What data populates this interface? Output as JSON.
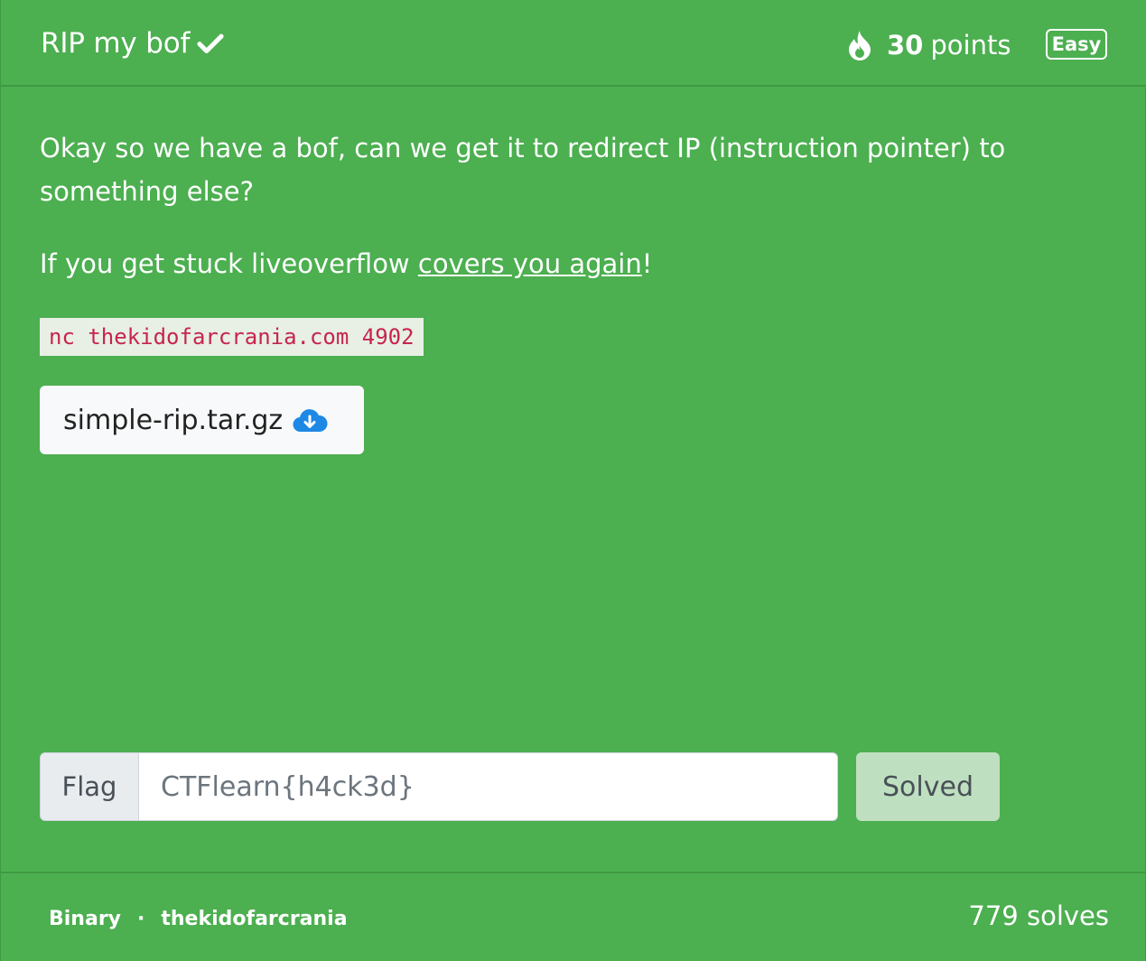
{
  "challenge": {
    "title": "RIP my bof",
    "points_value": "30",
    "points_label": "points",
    "difficulty": "Easy",
    "solved_icon": "check-icon",
    "points_icon": "fire-icon"
  },
  "description": {
    "paragraph_1": "Okay so we have a bof, can we get it to redirect IP (instruction pointer) to something else?",
    "paragraph_2_prefix": "If you get stuck liveoverflow ",
    "paragraph_2_link": "covers you again",
    "paragraph_2_suffix": "!",
    "connection": "nc thekidofarcrania.com 4902"
  },
  "attachment": {
    "filename": "simple-rip.tar.gz",
    "icon": "cloud-download-icon"
  },
  "flag_form": {
    "label": "Flag",
    "placeholder": "CTFlearn{h4ck3d}",
    "value": "",
    "submit_label": "Solved"
  },
  "footer": {
    "category": "Binary",
    "separator": "·",
    "author": "thekidofarcrania",
    "solves": "779 solves"
  },
  "colors": {
    "card_bg": "#4caf50",
    "code_text": "#c7254e",
    "cloud_icon": "#1e88e5",
    "solved_bg": "#bfe0c0"
  }
}
